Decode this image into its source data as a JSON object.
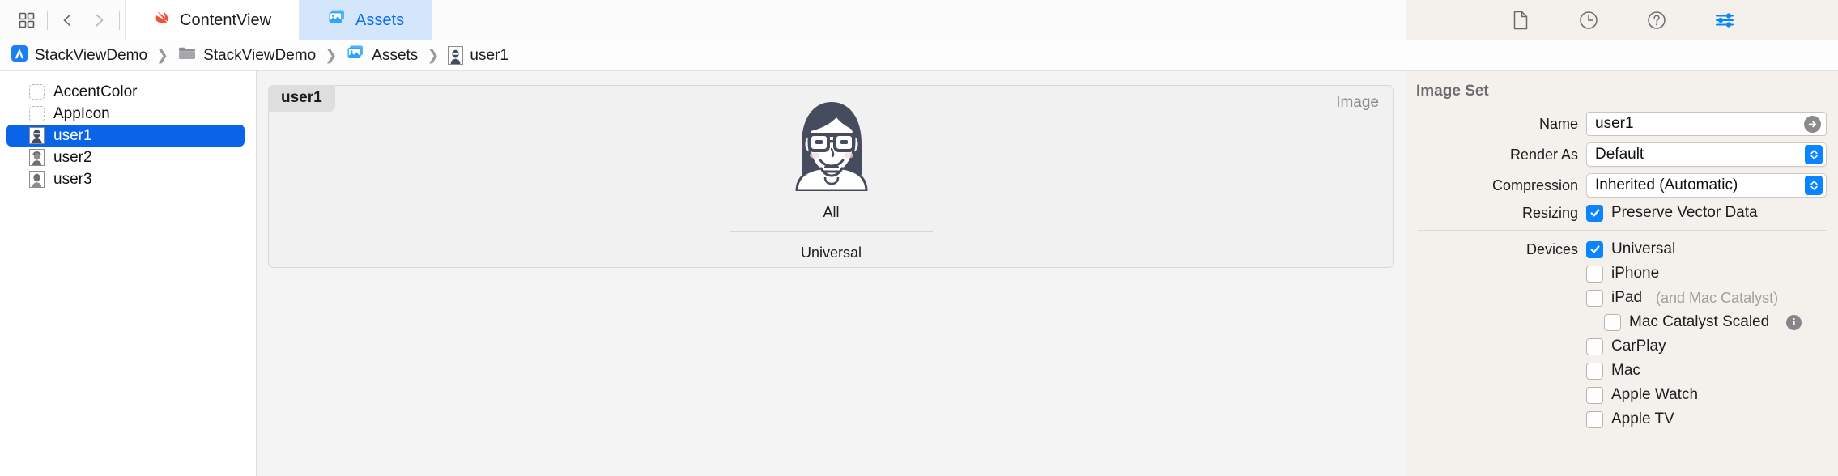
{
  "window": {
    "tabs": [
      {
        "label": "ContentView",
        "icon": "swift-file-icon",
        "active": false
      },
      {
        "label": "Assets",
        "icon": "assets-catalog-icon",
        "active": true
      }
    ],
    "toolbar_left_icons": [
      "grid-navigator-icon",
      "back-chevron-icon",
      "forward-chevron-icon"
    ],
    "toolbar_right_icons": [
      "compare-versions-icon",
      "more-options-icon",
      "toggle-inspector-icon"
    ],
    "inspector_tab_icons": [
      "file-inspector-icon",
      "history-inspector-icon",
      "quick-help-icon",
      "attributes-inspector-icon"
    ]
  },
  "breadcrumb": [
    {
      "label": "StackViewDemo",
      "icon": "xcode-project-icon"
    },
    {
      "label": "StackViewDemo",
      "icon": "folder-icon"
    },
    {
      "label": "Assets",
      "icon": "assets-catalog-icon"
    },
    {
      "label": "user1",
      "icon": "image-set-icon"
    }
  ],
  "breadcrumb_separator": "❯",
  "sidebar": {
    "items": [
      {
        "label": "AccentColor",
        "icon": "color-set-placeholder-icon",
        "selected": false
      },
      {
        "label": "AppIcon",
        "icon": "app-icon-placeholder-icon",
        "selected": false
      },
      {
        "label": "user1",
        "icon": "image-set-thumbnail-icon",
        "selected": true
      },
      {
        "label": "user2",
        "icon": "image-set-thumbnail-icon",
        "selected": false
      },
      {
        "label": "user3",
        "icon": "image-set-thumbnail-icon",
        "selected": false
      }
    ]
  },
  "canvas": {
    "card_title": "user1",
    "card_kind": "Image",
    "slot_caption": "All",
    "slot_sub": "Universal",
    "slot_image": "female-avatar-with-glasses"
  },
  "inspector": {
    "title": "Image Set",
    "name": {
      "label": "Name",
      "value": "user1",
      "action_icon": "arrow-right-circle-icon"
    },
    "render_as": {
      "label": "Render As",
      "value": "Default"
    },
    "compression": {
      "label": "Compression",
      "value": "Inherited (Automatic)"
    },
    "resizing": {
      "label": "Resizing",
      "option": "Preserve Vector Data",
      "checked": true
    },
    "devices": {
      "label": "Devices",
      "options": [
        {
          "label": "Universal",
          "checked": true,
          "note": "",
          "indent": false,
          "info": false
        },
        {
          "label": "iPhone",
          "checked": false,
          "note": "",
          "indent": false,
          "info": false
        },
        {
          "label": "iPad",
          "checked": false,
          "note": "(and Mac Catalyst)",
          "indent": false,
          "info": false
        },
        {
          "label": "Mac Catalyst Scaled",
          "checked": false,
          "note": "",
          "indent": true,
          "info": true
        },
        {
          "label": "CarPlay",
          "checked": false,
          "note": "",
          "indent": false,
          "info": false
        },
        {
          "label": "Mac",
          "checked": false,
          "note": "",
          "indent": false,
          "info": false
        },
        {
          "label": "Apple Watch",
          "checked": false,
          "note": "",
          "indent": false,
          "info": false
        },
        {
          "label": "Apple TV",
          "checked": false,
          "note": "",
          "indent": false,
          "info": false
        }
      ]
    }
  },
  "colors": {
    "accent_blue": "#0a84ff",
    "selection_blue": "#0a64e8",
    "active_tab_bg": "#d3e6fb",
    "inspector_bg": "#f4f0ec",
    "canvas_bg": "#f4f4f4"
  }
}
